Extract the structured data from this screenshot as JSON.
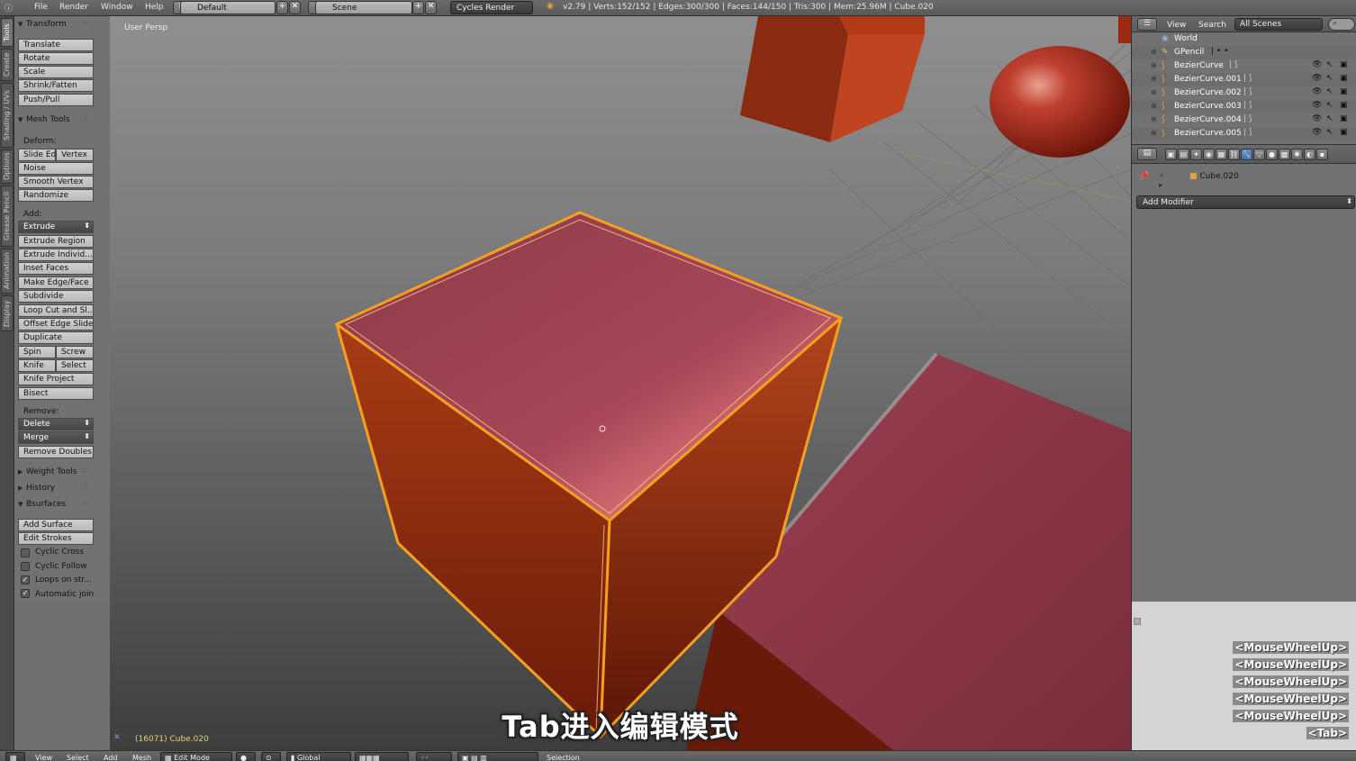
{
  "topbar": {
    "menu": [
      "File",
      "Render",
      "Window",
      "Help"
    ],
    "layout": "Default",
    "scene": "Scene",
    "engine": "Cycles Render",
    "stats": "v2.79 | Verts:152/152 | Edges:300/300 | Faces:144/150 | Tris:300 | Mem:25.96M | Cube.020"
  },
  "vtabs": [
    "Tools",
    "Create",
    "Shading / UVs",
    "Options",
    "Grease Pencil",
    "Animation",
    "Display"
  ],
  "toolshelf": {
    "transform": {
      "title": "Transform",
      "buttons": [
        "Translate",
        "Rotate",
        "Scale",
        "Shrink/Fatten",
        "Push/Pull"
      ]
    },
    "mesh_tools": {
      "title": "Mesh Tools",
      "deform_label": "Deform:",
      "slide_edge": "Slide Ed",
      "vertex": "Vertex",
      "noise": "Noise",
      "smooth_vertex": "Smooth Vertex",
      "randomize": "Randomize",
      "add_label": "Add:",
      "extrude": "Extrude",
      "extrude_region": "Extrude Region",
      "extrude_individual": "Extrude Individ...",
      "inset_faces": "Inset Faces",
      "make_edge_face": "Make Edge/Face",
      "subdivide": "Subdivide",
      "loop_cut": "Loop Cut and Sl...",
      "offset_edge_slide": "Offset Edge Slide",
      "duplicate": "Duplicate",
      "spin": "Spin",
      "screw": "Screw",
      "knife": "Knife",
      "select": "Select",
      "knife_project": "Knife Project",
      "bisect": "Bisect",
      "remove_label": "Remove:",
      "delete": "Delete",
      "merge": "Merge",
      "remove_doubles": "Remove Doubles"
    },
    "weight_tools": "Weight Tools",
    "history": "History",
    "bsurfaces": {
      "title": "Bsurfaces",
      "add_surface": "Add Surface",
      "edit_strokes": "Edit Strokes",
      "cyclic_cross": "Cyclic Cross",
      "cyclic_follow": "Cyclic Follow",
      "loops_on_strokes": "Loops on str...",
      "automatic_join": "Automatic join"
    }
  },
  "viewport": {
    "view_label": "User Persp",
    "object_info": "(16071) Cube.020",
    "subtitle": "Tab进入编辑模式"
  },
  "outliner": {
    "view": "View",
    "search": "Search",
    "scenes": "All Scenes",
    "rows": [
      "World",
      "GPencil",
      "BezierCurve",
      "BezierCurve.001",
      "BezierCurve.002",
      "BezierCurve.003",
      "BezierCurve.004",
      "BezierCurve.005"
    ]
  },
  "properties": {
    "object": "Cube.020",
    "add_modifier": "Add Modifier"
  },
  "key_display": [
    "<MouseWheelUp>",
    "<MouseWheelUp>",
    "<MouseWheelUp>",
    "<MouseWheelUp>",
    "<MouseWheelUp>",
    "<Tab>"
  ],
  "bottombar": {
    "menus": [
      "View",
      "Select",
      "Add",
      "Mesh"
    ],
    "mode": "Edit Mode",
    "orientation": "Global",
    "selection_label": "Selection"
  },
  "colors": {
    "cube_face": "#8c3a46",
    "cube_side": "#b0401a",
    "selection_edge": "#f5a020",
    "info_text": "#e8d36a"
  }
}
